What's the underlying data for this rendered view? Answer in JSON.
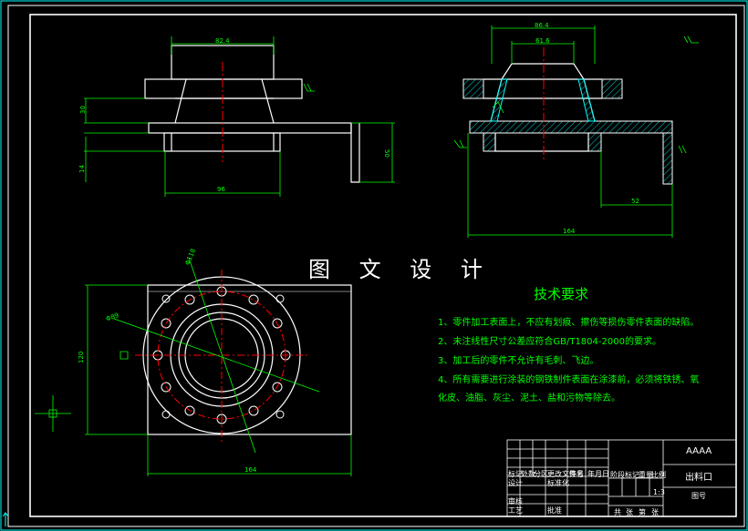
{
  "colors": {
    "background": "#000000",
    "frame": "#ffffff",
    "outline": "#ffffff",
    "dimension": "#00ff00",
    "centerline": "#ff0000",
    "hatch": "#00ffff",
    "section": "#00ffff",
    "text_green": "#00ff00",
    "banner": "#ffffff"
  },
  "banner": "图 文 设 计",
  "dimensions": {
    "front_top_width": "82.4",
    "front_base_width": "96",
    "front_left_h": "30",
    "front_small_h": "14",
    "front_right_h": "50",
    "section_outer_width": "86.4",
    "section_inner_width": "61.6",
    "section_right_width": "52",
    "section_total_width": "164",
    "plan_height": "120",
    "plan_width": "164",
    "plan_bolt_circle": "Φ118",
    "plan_bore": "Φ89"
  },
  "technical_requirements": {
    "title": "技术要求",
    "items": [
      "1、零件加工表面上，不应有划痕、擦伤等损伤零件表面的缺陷。",
      "2、未注线性尺寸公差应符合GB/T1804-2000的要求。",
      "3、加工后的零件不允许有毛刺、飞边。",
      "4、所有需要进行涂装的钢铁制件表面在涂漆前，必须将铁锈、氧",
      "化皮、油脂、灰尘、泥土、盐和污物等除去。"
    ]
  },
  "title_block": {
    "drawing_code": "AAAA",
    "part_name": "出料口",
    "drawing_number_label": "图号",
    "scale": "1:3",
    "row_labels": [
      "标记",
      "处数",
      "分区",
      "更改文件号",
      "签名",
      "年月日"
    ],
    "roles": [
      "设计",
      "标准化",
      "审核",
      "工艺",
      "批准"
    ],
    "stage_labels": [
      "阶段标记",
      "重量",
      "比例"
    ],
    "sheet_labels": [
      "共",
      "张",
      "第",
      "张"
    ]
  }
}
